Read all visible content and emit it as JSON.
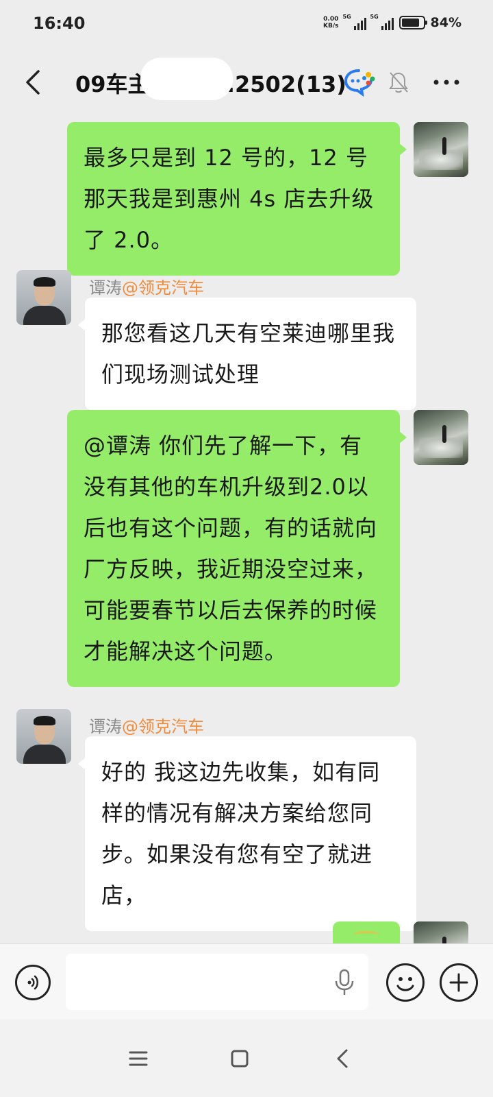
{
  "status_bar": {
    "time": "16:40",
    "net_speed_value": "0.00",
    "net_speed_unit": "KB/s",
    "signal1_label": "5G",
    "signal2_label": "5G",
    "battery_percent": "84%",
    "battery_level": 0.84
  },
  "header": {
    "title_prefix": "09车主",
    "title_suffix": "...2502(13)",
    "icons": [
      "back-arrow",
      "wecom-chat",
      "mute-bell",
      "more-dots"
    ]
  },
  "sender": {
    "name": "谭涛",
    "org": "@领克汽车"
  },
  "messages": [
    {
      "direction": "out",
      "text": "最多只是到 12 号的，12 号那天我是到惠州 4s 店去升级了 2.0。"
    },
    {
      "direction": "in",
      "text": "那您看这几天有空莱迪哪里我们现场测试处理"
    },
    {
      "direction": "out",
      "text": "@谭涛  你们先了解一下，有没有其他的车机升级到2.0以后也有这个问题，有的话就向厂方反映，我近期没空过来，可能要春节以后去保养的时候才能解决这个问题。"
    },
    {
      "direction": "in",
      "text": "好的   我这边先收集，如有同样的情况有解决方案给您同步。如果没有您有空了就进店，"
    },
    {
      "direction": "out",
      "text": ""
    }
  ],
  "input_bar": {
    "placeholder": "",
    "icons": [
      "voice",
      "microphone",
      "emoji",
      "plus"
    ]
  },
  "nav_bar": {
    "icons": [
      "menu",
      "home",
      "back"
    ]
  },
  "colors": {
    "background": "#ededed",
    "bubble_out": "#95ec69",
    "bubble_in": "#ffffff",
    "org_label": "#f08c3c",
    "sender_name": "#8a8a8a"
  }
}
